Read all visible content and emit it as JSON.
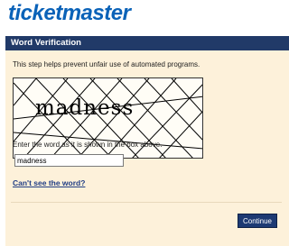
{
  "brand": {
    "logo_text": "ticketmaster",
    "color": "#0a62b8"
  },
  "header": {
    "title": "Word Verification",
    "bg_color": "#213a68"
  },
  "intro_text": "This step helps prevent unfair use of automated programs.",
  "captcha": {
    "word": "madness"
  },
  "prompt_text": "Enter the word as it is shown in the box above.",
  "answer_input": {
    "value": "madness"
  },
  "help_link": {
    "label": "Can't see the word?"
  },
  "continue_button": {
    "label": "Continue"
  },
  "panel_color": "#fdf1da"
}
